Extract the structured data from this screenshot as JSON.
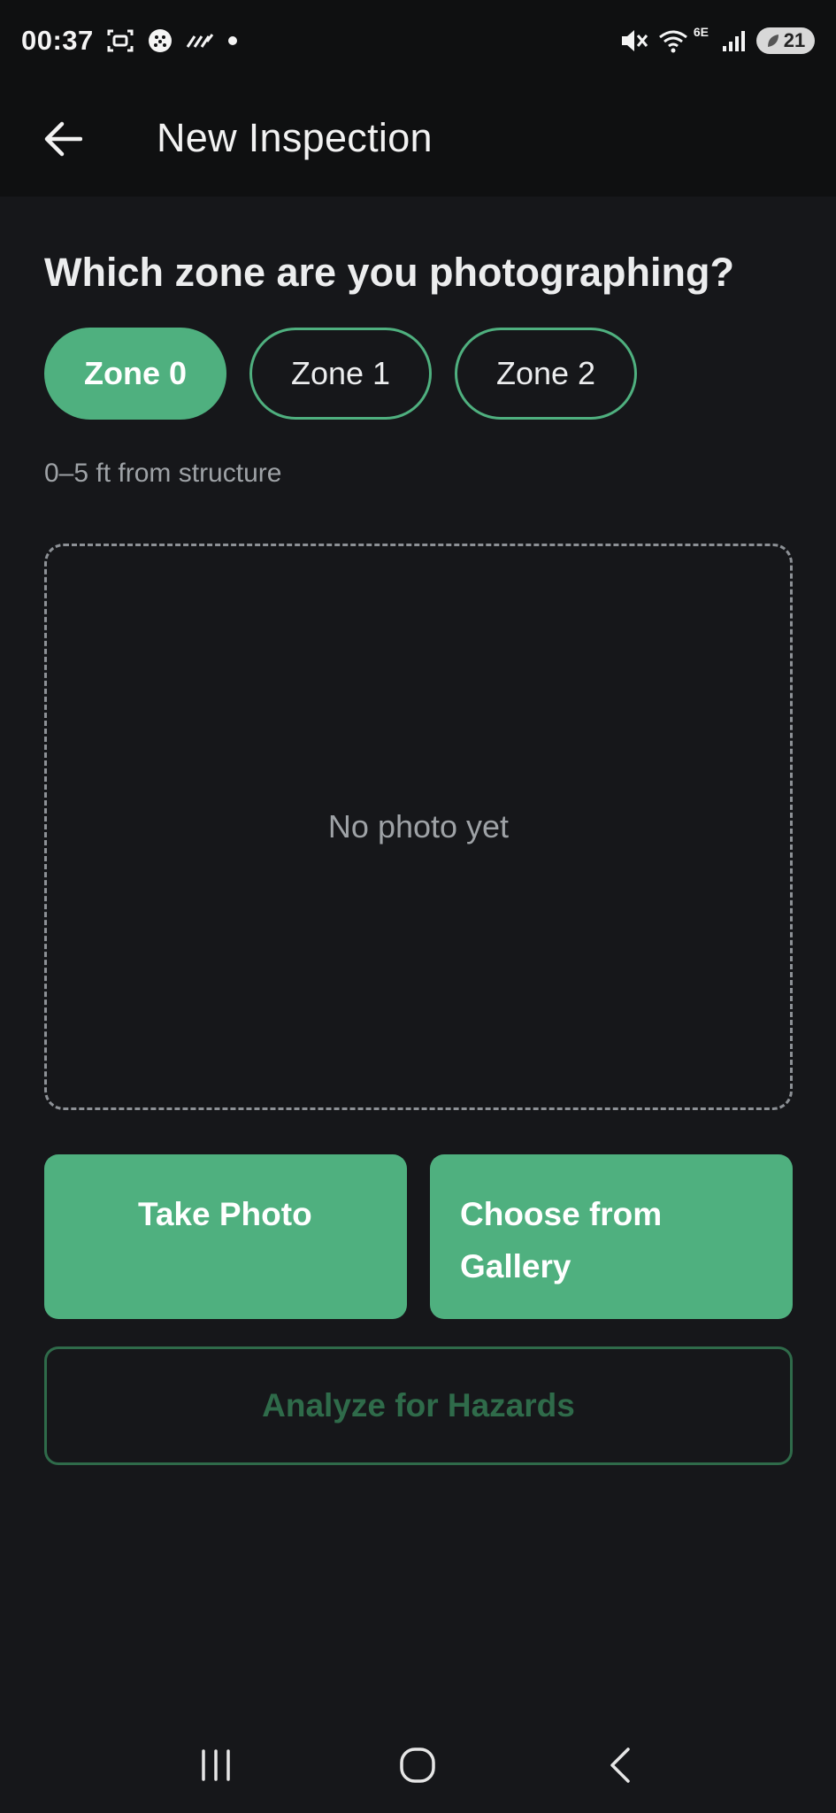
{
  "status_bar": {
    "time": "00:37",
    "network_type": "6E",
    "battery_level": "21",
    "icons": [
      "screenshot-icon",
      "app-dots-icon",
      "signal-stripes-icon",
      "notification-dot-icon",
      "mute-icon",
      "wifi-icon",
      "cellular-signal-icon",
      "battery-saver-icon"
    ]
  },
  "app_bar": {
    "title": "New Inspection",
    "back_icon": "arrow-left-icon"
  },
  "zone_selector": {
    "question": "Which zone are you photographing?",
    "zones": [
      {
        "label": "Zone 0",
        "selected": true
      },
      {
        "label": "Zone 1",
        "selected": false
      },
      {
        "label": "Zone 2",
        "selected": false
      }
    ],
    "hint": "0–5 ft from structure"
  },
  "photo_preview": {
    "empty_text": "No photo yet"
  },
  "actions": {
    "take_photo": "Take Photo",
    "choose_gallery_line1": "Choose from",
    "choose_gallery_line2": "Gallery",
    "analyze": "Analyze for Hazards"
  },
  "colors": {
    "accent": "#4fb07f",
    "accent_disabled": "#2f6b4a",
    "background": "#16171a",
    "bar_background": "#0f1011",
    "muted_text": "#9ea2a6"
  },
  "nav_bar": {
    "icons": [
      "recent-apps-icon",
      "home-icon",
      "back-nav-icon"
    ]
  }
}
